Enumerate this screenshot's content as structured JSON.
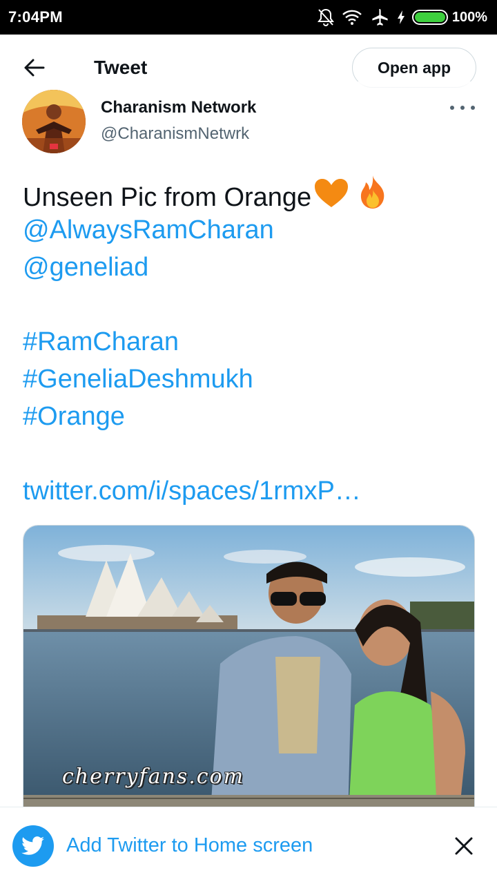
{
  "status_bar": {
    "time": "7:04PM",
    "battery_percent": "100%",
    "battery_level": 1.0,
    "icons": [
      "bell-muted-icon",
      "wifi-icon",
      "airplane-icon",
      "charging-bolt-icon",
      "battery-icon"
    ]
  },
  "header": {
    "title": "Tweet",
    "open_app_label": "Open app",
    "back_icon": "arrow-left-icon"
  },
  "tweet": {
    "author_name": "Charanism Network",
    "author_handle": "@CharanismNetwrk",
    "text_line_1": "Unseen Pic from Orange",
    "mention_1": "@AlwaysRamCharan",
    "mention_2": "@geneliad",
    "hashtag_1": "#RamCharan",
    "hashtag_2": "#GeneliaDeshmukh",
    "hashtag_3": "#Orange",
    "link": "twitter.com/i/spaces/1rmxP…",
    "emojis": [
      "orange-heart-icon",
      "fire-icon"
    ],
    "media_watermark": "cherryfans.com"
  },
  "banner": {
    "text": "Add Twitter to Home screen",
    "logo_icon": "twitter-bird-icon",
    "close_icon": "close-icon"
  },
  "colors": {
    "link_blue": "#1d9bf0",
    "text_primary": "#0f1419",
    "text_secondary": "#536471",
    "status_bar_bg": "#000000"
  }
}
